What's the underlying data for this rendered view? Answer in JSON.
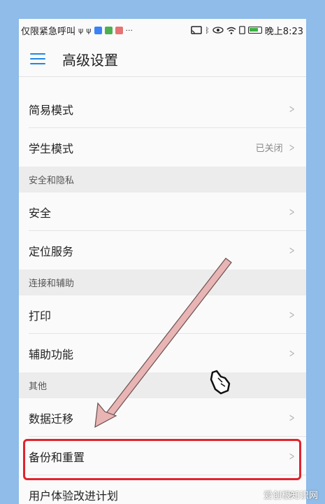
{
  "status_bar": {
    "carrier_text": "仅限紧急呼叫",
    "time": "晚上8:23",
    "left_icons": [
      "usb-icon",
      "usb-icon",
      "app-icon-blue",
      "app-icon-green",
      "app-icon-red",
      "more-dots-icon"
    ],
    "right_icons": [
      "cast-icon",
      "bluetooth-icon",
      "eye-icon",
      "wifi-icon",
      "sim-icon",
      "battery-icon"
    ]
  },
  "app_bar": {
    "title": "高级设置"
  },
  "list": {
    "partial_label": "...",
    "items": [
      {
        "label": "简易模式",
        "value": ""
      },
      {
        "label": "学生模式",
        "value": "已关闭"
      }
    ],
    "sections": [
      {
        "header": "安全和隐私",
        "items": [
          {
            "label": "安全"
          },
          {
            "label": "定位服务"
          }
        ]
      },
      {
        "header": "连接和辅助",
        "items": [
          {
            "label": "打印"
          },
          {
            "label": "辅助功能"
          }
        ]
      },
      {
        "header": "其他",
        "items": [
          {
            "label": "数据迁移"
          },
          {
            "label": "备份和重置"
          },
          {
            "label": "用户体验改进计划"
          }
        ]
      }
    ]
  },
  "annotation": {
    "highlight_color": "#e1232e",
    "arrow_color": "#e8b4b4",
    "highlighted_item": "备份和重置"
  },
  "watermark": "爱创根知识网"
}
